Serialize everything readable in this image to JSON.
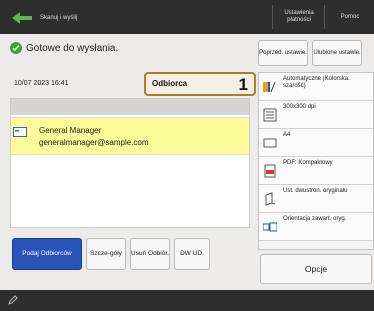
{
  "header": {
    "title": "Skanuj i wyślij",
    "settings_registration": "Ustawienia płatności",
    "help": "Pomoc"
  },
  "status": {
    "text": "Gotowe do wysłania.",
    "datetime": "10/07 2023 16:41"
  },
  "recipients": {
    "label": "Odbiorca",
    "count": "1",
    "list": [
      {
        "name": "General Manager",
        "email": "generalmanager@sample.com"
      }
    ]
  },
  "bottom_buttons": {
    "specify": "Podaj Odbiorców",
    "details": "Szcze-góły",
    "delete": "Usuń Odbiór.",
    "cc_bcc": "DW UD."
  },
  "right_panel": {
    "previous_settings": "Poprzed. ustawie.",
    "favorite_settings": "Ulubione ustawie.",
    "settings": [
      {
        "icon": "color-mode-icon",
        "label": "Automatyczne (Kolorska. szarość)"
      },
      {
        "icon": "resolution-icon",
        "label": "300x300 dpi"
      },
      {
        "icon": "paper-size-icon",
        "label": "A4"
      },
      {
        "icon": "file-format-icon",
        "label": "PDF: Kompaktowy"
      },
      {
        "icon": "duplex-icon",
        "label": "Ust. dwustron. oryginału"
      },
      {
        "icon": "orientation-icon",
        "label": "Orientacja zawart. oryg."
      }
    ],
    "options": "Opcje"
  },
  "colors": {
    "accent_blue": "#2a53b8",
    "status_green": "#3aa335",
    "selected_row": "#fbfb99",
    "recipients_border": "#b37a2b"
  }
}
